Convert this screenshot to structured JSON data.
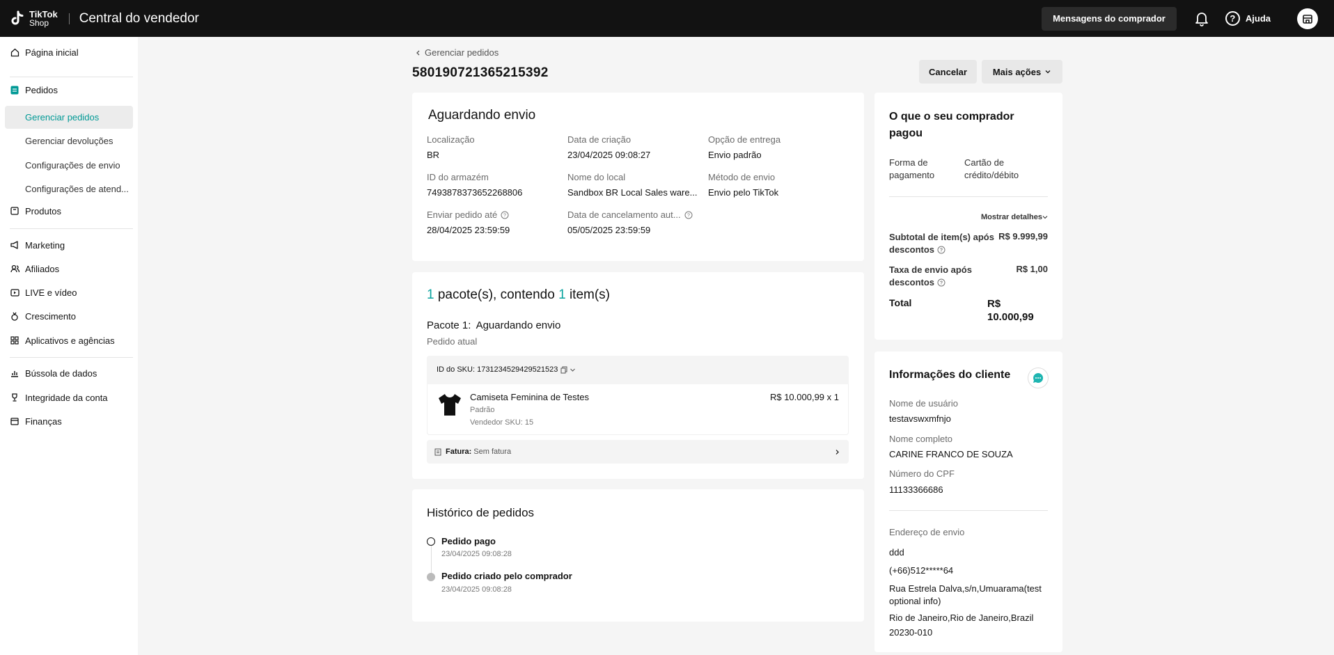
{
  "header": {
    "logo_line1": "TikTok",
    "logo_line2": "Shop",
    "title": "Central do vendedor",
    "buyer_messages": "Mensagens do comprador",
    "help": "Ajuda"
  },
  "sidebar": {
    "home": "Página inicial",
    "orders": "Pedidos",
    "orders_sub": [
      "Gerenciar pedidos",
      "Gerenciar devoluções",
      "Configurações de envio",
      "Configurações de atend..."
    ],
    "products": "Produtos",
    "marketing": "Marketing",
    "affiliates": "Afiliados",
    "live": "LIVE e vídeo",
    "growth": "Crescimento",
    "apps": "Aplicativos e agências",
    "compass": "Bússola de dados",
    "integrity": "Integridade da conta",
    "finance": "Finanças"
  },
  "page": {
    "breadcrumb": "Gerenciar pedidos",
    "order_id": "580190721365215392",
    "cancel": "Cancelar",
    "more_actions": "Mais ações"
  },
  "status": {
    "title": "Aguardando envio",
    "fields": [
      {
        "label": "Localização",
        "value": "BR"
      },
      {
        "label": "Data de criação",
        "value": "23/04/2025 09:08:27"
      },
      {
        "label": "Opção de entrega",
        "value": "Envio padrão"
      },
      {
        "label": "ID do armazém",
        "value": "7493878373652268806"
      },
      {
        "label": "Nome do local",
        "value": "Sandbox BR Local Sales ware..."
      },
      {
        "label": "Método de envio",
        "value": "Envio pelo TikTok"
      },
      {
        "label": "Enviar pedido até",
        "value": "28/04/2025 23:59:59"
      },
      {
        "label": "Data de cancelamento aut...",
        "value": "05/05/2025 23:59:59"
      }
    ]
  },
  "package": {
    "count": "1",
    "text1": "pacote(s), contendo",
    "items": "1",
    "text2": "item(s)",
    "package_label": "Pacote 1:",
    "package_status": "Aguardando envio",
    "current": "Pedido atual",
    "sku_id": "ID do SKU: 1731234529429521523",
    "product_name": "Camiseta Feminina de Testes",
    "variant": "Padrão",
    "seller_sku": "Vendedor SKU: 15",
    "price": "R$ 10.000,99 x 1",
    "invoice_label": "Fatura:",
    "invoice_value": "Sem fatura"
  },
  "history": {
    "title": "Histórico de pedidos",
    "events": [
      {
        "title": "Pedido pago",
        "time": "23/04/2025 09:08:28"
      },
      {
        "title": "Pedido criado pelo comprador",
        "time": "23/04/2025 09:08:28"
      }
    ]
  },
  "payment": {
    "title": "O que o seu comprador pagou",
    "method_label": "Forma de pagamento",
    "method_value": "Cartão de crédito/débito",
    "show_details": "Mostrar detalhes",
    "subtotal_label": "Subtotal de item(s) após descontos",
    "subtotal_value": "R$ 9.999,99",
    "shipping_label": "Taxa de envio após descontos",
    "shipping_value": "R$ 1,00",
    "total_label": "Total",
    "total_value": "R$ 10.000,99"
  },
  "customer": {
    "title": "Informações do cliente",
    "username_label": "Nome de usuário",
    "username": "testavswxmfnjo",
    "fullname_label": "Nome completo",
    "fullname": "CARINE FRANCO DE SOUZA",
    "cpf_label": "Número do CPF",
    "cpf": "11133366686",
    "address_label": "Endereço de envio",
    "addr_name": "ddd",
    "addr_phone": "(+66)512*****64",
    "addr_line1": "Rua Estrela Dalva,s/n,Umuarama(test optional info)",
    "addr_line2": "Rio de Janeiro,Rio de Janeiro,Brazil 20230-010"
  },
  "colors": {
    "accent": "#009995",
    "topbar": "#121212"
  }
}
